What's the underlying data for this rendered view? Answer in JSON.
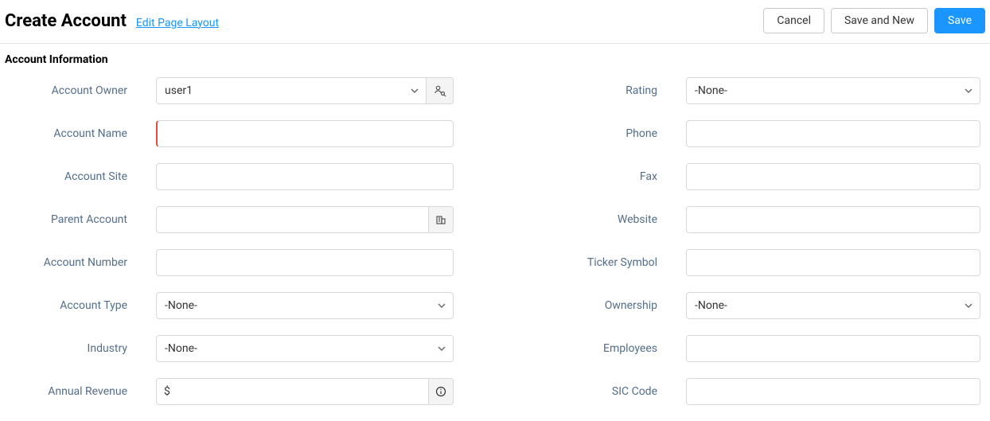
{
  "header": {
    "title": "Create Account",
    "edit_link": "Edit Page Layout",
    "cancel": "Cancel",
    "save_new": "Save and New",
    "save": "Save"
  },
  "section": {
    "title": "Account Information"
  },
  "labels": {
    "account_owner": "Account Owner",
    "account_name": "Account Name",
    "account_site": "Account Site",
    "parent_account": "Parent Account",
    "account_number": "Account Number",
    "account_type": "Account Type",
    "industry": "Industry",
    "annual_revenue": "Annual Revenue",
    "rating": "Rating",
    "phone": "Phone",
    "fax": "Fax",
    "website": "Website",
    "ticker_symbol": "Ticker Symbol",
    "ownership": "Ownership",
    "employees": "Employees",
    "sic_code": "SIC Code"
  },
  "values": {
    "account_owner": "user1",
    "account_name": "",
    "account_site": "",
    "parent_account": "",
    "account_number": "",
    "account_type": "-None-",
    "industry": "-None-",
    "annual_revenue": "",
    "rating": "-None-",
    "phone": "",
    "fax": "",
    "website": "",
    "ticker_symbol": "",
    "ownership": "-None-",
    "employees": "",
    "sic_code": ""
  },
  "currency_symbol": "$"
}
